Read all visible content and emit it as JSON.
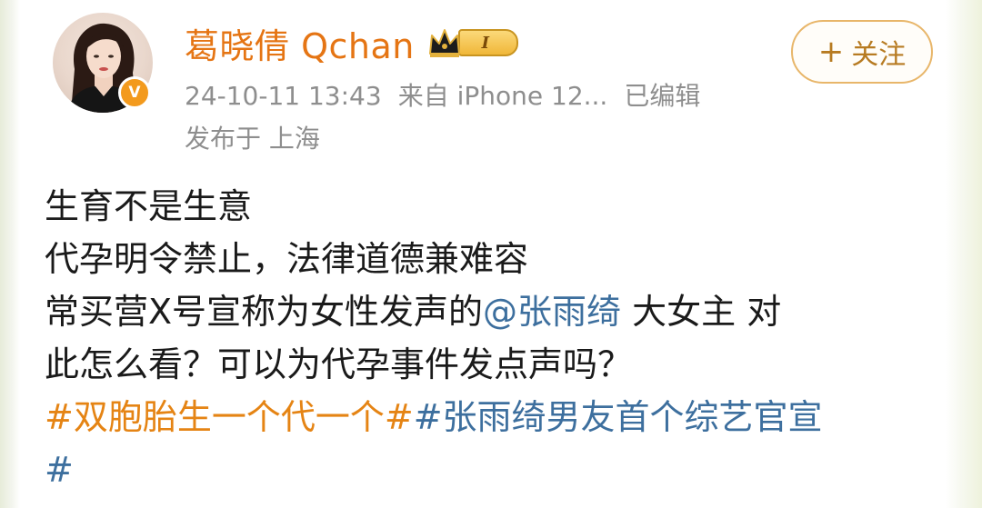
{
  "user": {
    "name": "葛晓倩 Qchan",
    "verified_badge": "V",
    "level_badge": "I",
    "level_icon": "crown-icon"
  },
  "meta": {
    "time": "24-10-11 13:43",
    "source": "来自 iPhone 12...",
    "edited": "已编辑"
  },
  "location": "发布于 上海",
  "follow_button": {
    "plus": "+",
    "label": "关注"
  },
  "post": {
    "line1": "生育不是生意",
    "line2": "代孕明令禁止，法律道德兼难容",
    "line3_prefix": "常买营X号宣称为女性发声的",
    "line3_mention": "@张雨绮",
    "line3_suffix": " 大女主 对",
    "line4": "此怎么看？可以为代孕事件发点声吗？",
    "hashtag1": "#双胞胎生一个代一个#",
    "hashtag2": "#张雨绮男友首个综艺官宣",
    "hashtag2_end": "#"
  },
  "colors": {
    "username": "#e57514",
    "meta": "#8e8e8e",
    "mention": "#3d6f9e",
    "hashtag_orange": "#e58414",
    "follow_border": "#e8b66a"
  }
}
